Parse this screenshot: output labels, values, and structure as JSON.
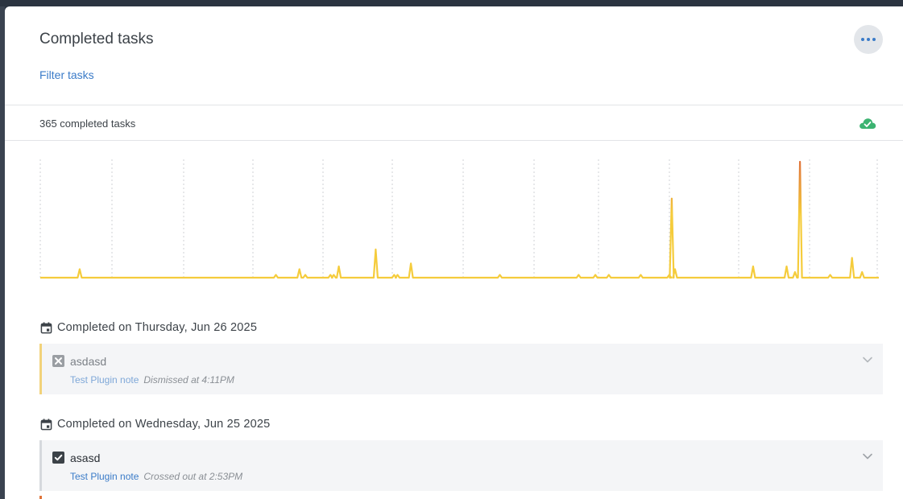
{
  "header": {
    "title": "Completed tasks",
    "filter_label": "Filter tasks",
    "more_icon": "ellipsis-icon"
  },
  "summary": {
    "count_text": "365 completed tasks",
    "sync_icon": "cloud-check-icon",
    "sync_color": "#3cb371"
  },
  "chart_data": {
    "type": "line",
    "title": "",
    "xlabel": "",
    "ylabel": "",
    "grid": "vertical-dashed",
    "colors": {
      "low": "#f5cc3c",
      "high": "#e0743a"
    },
    "values": [
      0,
      0,
      0,
      0,
      0,
      0,
      0,
      0,
      0,
      0,
      3,
      0,
      0,
      0,
      0,
      0,
      0,
      0,
      0,
      0,
      0,
      0,
      0,
      0,
      0,
      0,
      0,
      0,
      0,
      0,
      0,
      0,
      0,
      0,
      0,
      0,
      0,
      0,
      0,
      0,
      0,
      0,
      0,
      0,
      0,
      0,
      0,
      0,
      0,
      0,
      0,
      0,
      0,
      0,
      0,
      0,
      0,
      0,
      0,
      0,
      0,
      0,
      0,
      0,
      0,
      0,
      0,
      0,
      0,
      0,
      0,
      0,
      0,
      0,
      0,
      0,
      0,
      0,
      0,
      0,
      0,
      0,
      0,
      0,
      0,
      0,
      0,
      0,
      0,
      0,
      0,
      0,
      0,
      0,
      0,
      0,
      0,
      0,
      0,
      0,
      0,
      0,
      0,
      0,
      0,
      0,
      0,
      0,
      0,
      0,
      0,
      0,
      0,
      0,
      0,
      0,
      0,
      0,
      0,
      0,
      0,
      0,
      0,
      0,
      0,
      0,
      0,
      0,
      0,
      0,
      0,
      0,
      0,
      0,
      0,
      0,
      0,
      0,
      0,
      0,
      0,
      0,
      0,
      0,
      0,
      0,
      0,
      0,
      0,
      0,
      0,
      0,
      0,
      0,
      0,
      0,
      0,
      0,
      0,
      0,
      0,
      0,
      0,
      0,
      0,
      0,
      0,
      0,
      0,
      0,
      0,
      0,
      0,
      0,
      0,
      0,
      0,
      0,
      1,
      0,
      0,
      0,
      0,
      0,
      0,
      0,
      0,
      0,
      0,
      0,
      0,
      0,
      0,
      0,
      0,
      0,
      0,
      0,
      0,
      0,
      0,
      0,
      0,
      0,
      0,
      0,
      0,
      0,
      0,
      0,
      0,
      0,
      0,
      0,
      0,
      0,
      0,
      0,
      0,
      0,
      0,
      0,
      0,
      0,
      0,
      0,
      0,
      0,
      0,
      0,
      0,
      0,
      0,
      0,
      0,
      0,
      0,
      0,
      0,
      0,
      0,
      0,
      0,
      0,
      0,
      0,
      0,
      0,
      0,
      0,
      0,
      0,
      0,
      0,
      0,
      0,
      0,
      0,
      0,
      0,
      0,
      0,
      0,
      0,
      0,
      0,
      0,
      0,
      0,
      0,
      0,
      0,
      0,
      0,
      0,
      0,
      0,
      0,
      0,
      0,
      0,
      0,
      0,
      0,
      0,
      0,
      0,
      0,
      0,
      0,
      0,
      0,
      0,
      0,
      0,
      0,
      0,
      0,
      0,
      0,
      0,
      0,
      0,
      0,
      0,
      0,
      0,
      0,
      0,
      0,
      0,
      0,
      0,
      0,
      0,
      0,
      0,
      0,
      0,
      0,
      0,
      0,
      0,
      0,
      0,
      0,
      0,
      0,
      0,
      0,
      0,
      0,
      0,
      0,
      0,
      0,
      0,
      0,
      0,
      0,
      0,
      0,
      0,
      0,
      0,
      0,
      0,
      0,
      0,
      0,
      0,
      0,
      0,
      0,
      0,
      0,
      0,
      0,
      0,
      0,
      0,
      0,
      0,
      0,
      0,
      0,
      0,
      0,
      0,
      0,
      0,
      0,
      0,
      0,
      0,
      0
    ],
    "peaks": [
      {
        "x": 0.047,
        "y": 3
      },
      {
        "x": 0.281,
        "y": 1
      },
      {
        "x": 0.309,
        "y": 3
      },
      {
        "x": 0.316,
        "y": 1
      },
      {
        "x": 0.346,
        "y": 1
      },
      {
        "x": 0.35,
        "y": 1
      },
      {
        "x": 0.356,
        "y": 4
      },
      {
        "x": 0.4,
        "y": 10
      },
      {
        "x": 0.422,
        "y": 1
      },
      {
        "x": 0.426,
        "y": 1
      },
      {
        "x": 0.442,
        "y": 5
      },
      {
        "x": 0.548,
        "y": 1
      },
      {
        "x": 0.642,
        "y": 1
      },
      {
        "x": 0.662,
        "y": 1
      },
      {
        "x": 0.678,
        "y": 1
      },
      {
        "x": 0.716,
        "y": 1
      },
      {
        "x": 0.75,
        "y": 1
      },
      {
        "x": 0.753,
        "y": 28
      },
      {
        "x": 0.757,
        "y": 3
      },
      {
        "x": 0.85,
        "y": 4
      },
      {
        "x": 0.89,
        "y": 4
      },
      {
        "x": 0.9,
        "y": 2
      },
      {
        "x": 0.906,
        "y": 41
      },
      {
        "x": 0.942,
        "y": 1
      },
      {
        "x": 0.968,
        "y": 7
      },
      {
        "x": 0.98,
        "y": 2
      }
    ],
    "ylim": [
      0,
      41
    ]
  },
  "groups": [
    {
      "heading": "Completed on Thursday, Jun 26 2025",
      "task": {
        "name": "asdasd",
        "note": "Test Plugin note",
        "status": "Dismissed at 4:11PM",
        "state": "dismissed",
        "accent": "#f2d27a"
      }
    },
    {
      "heading": "Completed on Wednesday, Jun 25 2025",
      "task": {
        "name": "asasd",
        "note": "Test Plugin note",
        "status": "Crossed out at 2:53PM",
        "state": "crossed",
        "accent": "#d6d9dd"
      }
    }
  ]
}
